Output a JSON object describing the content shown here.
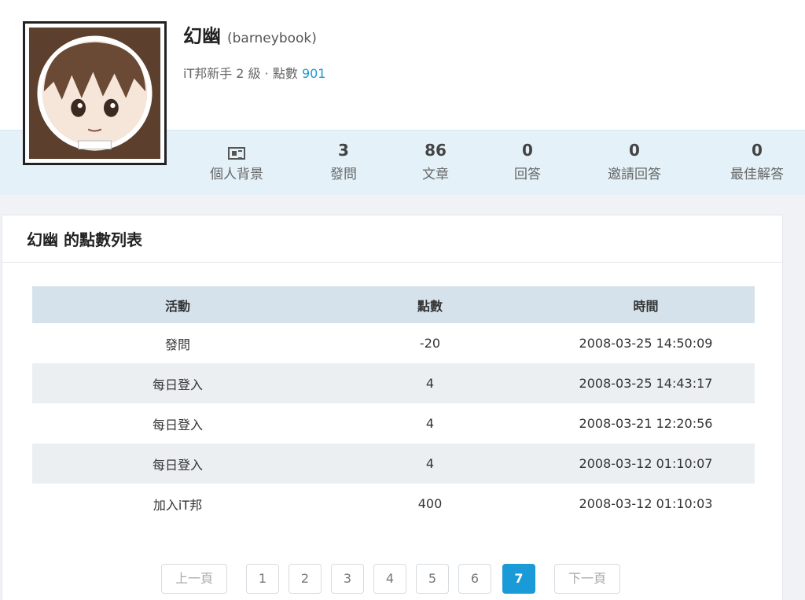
{
  "profile": {
    "name": "幻幽",
    "username": "(barneybook)",
    "level": "iT邦新手 2 級 · 點數",
    "points": "901"
  },
  "stats": [
    {
      "value": "",
      "label": "個人背景",
      "icon": "profile-icon"
    },
    {
      "value": "3",
      "label": "發問"
    },
    {
      "value": "86",
      "label": "文章"
    },
    {
      "value": "0",
      "label": "回答"
    },
    {
      "value": "0",
      "label": "邀請回答"
    },
    {
      "value": "0",
      "label": "最佳解答"
    }
  ],
  "card": {
    "title": "幻幽 的點數列表"
  },
  "table": {
    "headers": [
      "活動",
      "點數",
      "時間"
    ],
    "rows": [
      [
        "發問",
        "-20",
        "2008-03-25 14:50:09"
      ],
      [
        "每日登入",
        "4",
        "2008-03-25 14:43:17"
      ],
      [
        "每日登入",
        "4",
        "2008-03-21 12:20:56"
      ],
      [
        "每日登入",
        "4",
        "2008-03-12 01:10:07"
      ],
      [
        "加入iT邦",
        "400",
        "2008-03-12 01:10:03"
      ]
    ]
  },
  "pagination": {
    "prev": "上一頁",
    "pages": [
      "1",
      "2",
      "3",
      "4",
      "5",
      "6",
      "7"
    ],
    "active": "7",
    "next": "下一頁"
  },
  "colors": {
    "accent": "#1a9ad6",
    "strip": "#e4f1f8",
    "table_header": "#d5e2ec"
  }
}
